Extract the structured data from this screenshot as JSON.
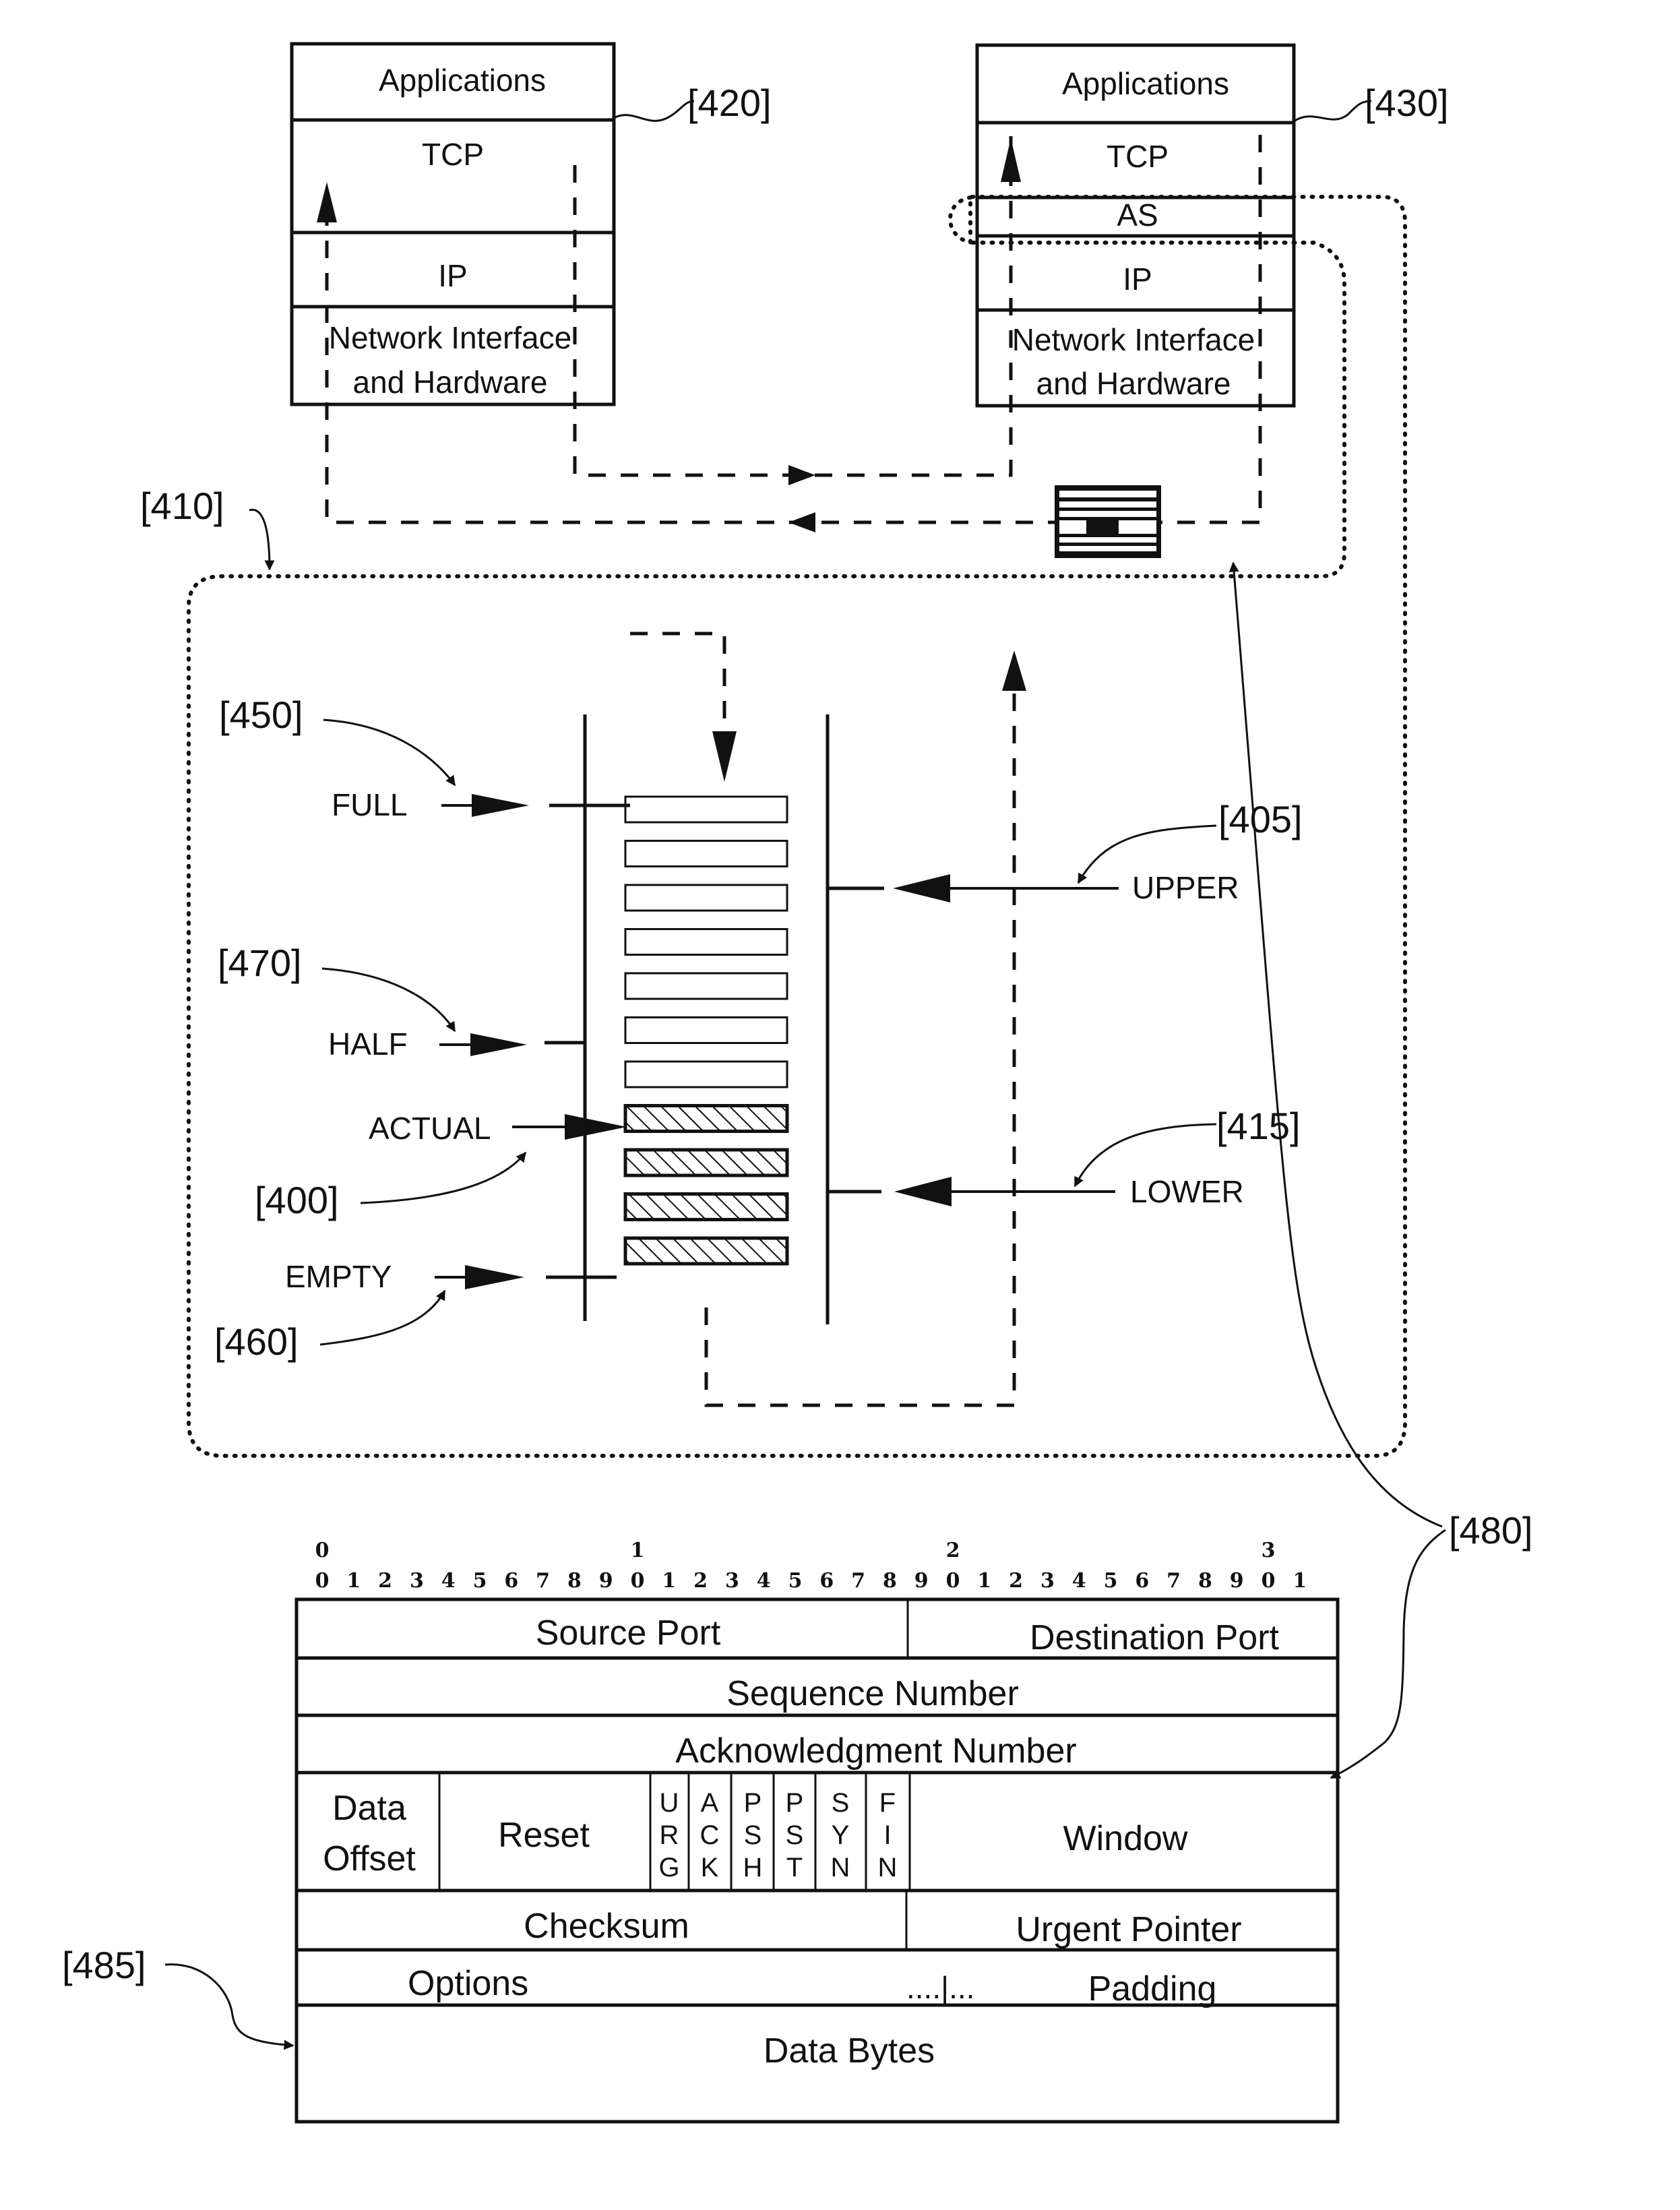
{
  "stacks": {
    "left": {
      "ref": "[420]",
      "layers": [
        "Applications",
        "TCP",
        "IP",
        "Network Interface",
        "and Hardware"
      ]
    },
    "right": {
      "ref": "[430]",
      "layers": [
        "Applications",
        "TCP",
        "AS",
        "IP",
        "Network Interface",
        "and Hardware"
      ]
    }
  },
  "buffer": {
    "ref": "[410]",
    "total_slots": 11,
    "filled_slots": 4,
    "markers": {
      "full": {
        "label": "FULL",
        "ref": "[450]"
      },
      "half": {
        "label": "HALF",
        "ref": "[470]"
      },
      "actual": {
        "label": "ACTUAL",
        "ref": "[400]"
      },
      "empty": {
        "label": "EMPTY",
        "ref": "[460]"
      },
      "upper": {
        "label": "UPPER",
        "ref": "[405]"
      },
      "lower": {
        "label": "LOWER",
        "ref": "[415]"
      }
    }
  },
  "header_ref": "[480]",
  "options_ref": "[485]",
  "tcp_header": {
    "bit_tens": [
      "0",
      "1",
      "2",
      "3"
    ],
    "bit_units": [
      "0",
      "1",
      "2",
      "3",
      "4",
      "5",
      "6",
      "7",
      "8",
      "9",
      "0",
      "1",
      "2",
      "3",
      "4",
      "5",
      "6",
      "7",
      "8",
      "9",
      "0",
      "1",
      "2",
      "3",
      "4",
      "5",
      "6",
      "7",
      "8",
      "9",
      "0",
      "1"
    ],
    "source_port": "Source Port",
    "destination_port": "Destination Port",
    "sequence_number": "Sequence Number",
    "acknowledgment_number": "Acknowledgment Number",
    "data_offset": [
      "Data",
      "Offset"
    ],
    "reset": "Reset",
    "flags": [
      [
        "U",
        "R",
        "G"
      ],
      [
        "A",
        "C",
        "K"
      ],
      [
        "P",
        "S",
        "H"
      ],
      [
        "P",
        "S",
        "T"
      ],
      [
        "S",
        "Y",
        "N"
      ],
      [
        "F",
        "I",
        "N"
      ]
    ],
    "window": "Window",
    "checksum": "Checksum",
    "urgent_pointer": "Urgent Pointer",
    "options": "Options",
    "separator": "....|...",
    "padding": "Padding",
    "data_bytes": "Data Bytes"
  }
}
